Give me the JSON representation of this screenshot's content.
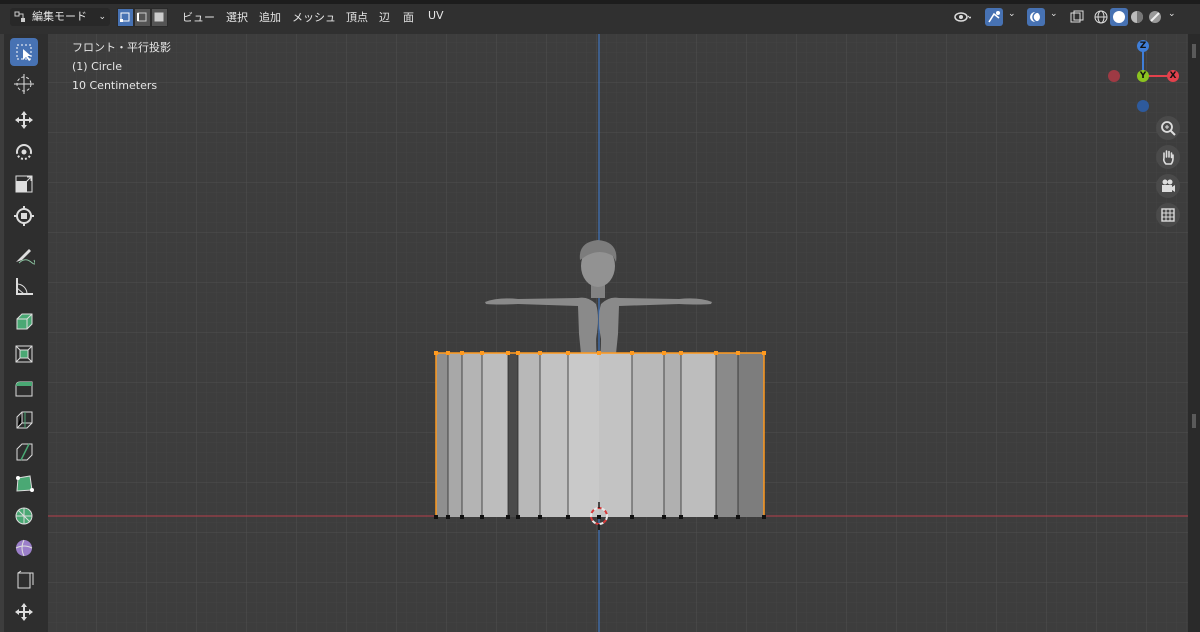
{
  "header": {
    "mode_label": "編集モード",
    "menus": [
      "ビュー",
      "選択",
      "追加",
      "メッシュ",
      "頂点",
      "辺",
      "面",
      "UV"
    ]
  },
  "overlay": {
    "view_name": "フロント・平行投影",
    "object_name": "(1) Circle",
    "grid_scale": "10 Centimeters"
  },
  "gizmo": {
    "z": "Z",
    "y": "Y",
    "x": "X"
  },
  "tools": [
    "select-box-icon",
    "cursor-icon",
    "move-icon",
    "rotate-icon",
    "scale-icon",
    "transform-icon",
    "annotate-icon",
    "measure-icon",
    "extrude-icon",
    "inset-icon",
    "bevel-icon",
    "loop-cut-icon",
    "knife-icon",
    "poly-build-icon",
    "spin-icon",
    "smooth-icon",
    "shear-icon",
    "rip-icon"
  ],
  "colors": {
    "accent": "#4772b3",
    "x_axis": "#e2414c",
    "y_axis": "#8bc320",
    "z_axis": "#3f7ed8",
    "selection": "#ff9a1f"
  }
}
